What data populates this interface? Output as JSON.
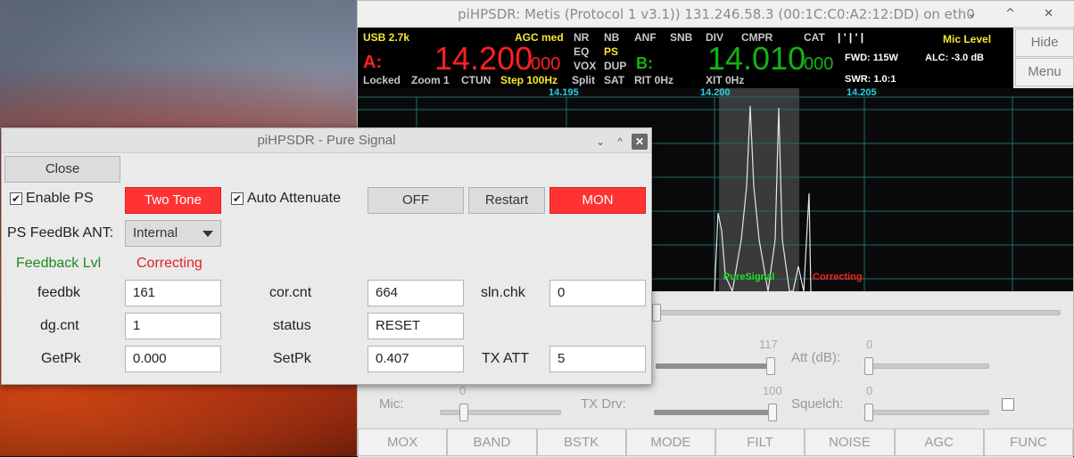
{
  "main_window": {
    "title": "piHPSDR: Metis (Protocol 1 v3.1)) 131.246.58.3 (00:1C:C0:A2:12:DD) on eth0",
    "controls": "⌄ ^ ✕",
    "side_buttons": {
      "hide": "Hide",
      "menu": "Menu"
    },
    "vfo": {
      "mode": "USB 2.7k",
      "agc": "AGC med",
      "a_label": "A:",
      "a_freq_main": "14.200",
      "a_freq_sub": "000",
      "b_label": "B:",
      "b_freq_main": "14.010",
      "b_freq_sub": "000",
      "flags_row1": [
        "NR",
        "NB",
        "ANF",
        "SNB",
        "DIV",
        "CMPR",
        "CAT"
      ],
      "flags_row2": [
        "EQ",
        "PS"
      ],
      "flags_row3": [
        "VOX",
        "DUP"
      ],
      "flags_row4": [
        "Split",
        "SAT",
        "RIT 0Hz",
        "XIT 0Hz"
      ],
      "locked": "Locked",
      "zoom": "Zoom 1",
      "ctun": "CTUN",
      "step": "Step 100Hz",
      "mic_level": "Mic Level",
      "fwd": "FWD: 115W",
      "alc": "ALC: -3.0 dB",
      "swr": "SWR: 1.0:1",
      "meter_ticks": "|    '    |    '    |"
    },
    "spectrum": {
      "freq_labels": [
        "14.195",
        "14.200",
        "14.205"
      ],
      "puresignal_label": "PureSignal",
      "correcting_label": "Correcting"
    },
    "lower": {
      "att_label": "Att (dB):",
      "att_value": "0",
      "rf_value": "117",
      "mic_label": "Mic:",
      "mic_value": "0",
      "txdrv_label": "TX Drv:",
      "txdrv_value": "100",
      "squelch_label": "Squelch:",
      "squelch_value": "0"
    },
    "bottom_buttons": [
      "MOX",
      "BAND",
      "BSTK",
      "MODE",
      "FILT",
      "NOISE",
      "AGC",
      "FUNC"
    ]
  },
  "ps_dialog": {
    "title": "piHPSDR - Pure Signal",
    "close_btn": "Close",
    "enable_ps": "Enable PS",
    "two_tone": "Two Tone",
    "auto_attenuate": "Auto Attenuate",
    "off_btn": "OFF",
    "restart_btn": "Restart",
    "mon_btn": "MON",
    "feedbk_ant_label": "PS FeedBk ANT:",
    "feedbk_ant_value": "Internal",
    "feedback_lvl": "Feedback Lvl",
    "correcting": "Correcting",
    "fields": {
      "feedbk_label": "feedbk",
      "feedbk": "161",
      "corcnt_label": "cor.cnt",
      "corcnt": "664",
      "slnchk_label": "sln.chk",
      "slnchk": "0",
      "dgcnt_label": "dg.cnt",
      "dgcnt": "1",
      "status_label": "status",
      "status": "RESET",
      "getpk_label": "GetPk",
      "getpk": "0.000",
      "setpk_label": "SetPk",
      "setpk": "0.407",
      "txatt_label": "TX ATT",
      "txatt": "5"
    }
  }
}
